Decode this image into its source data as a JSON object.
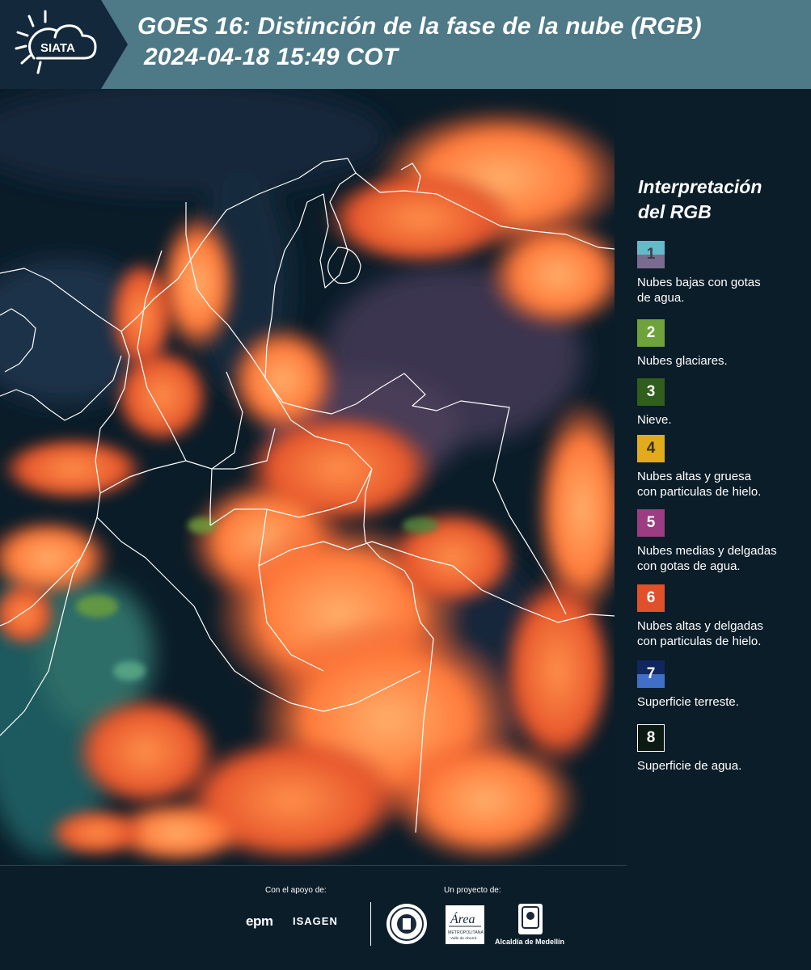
{
  "header": {
    "logo_text": "SIATA",
    "title_line1": "GOES 16: Distinción de la fase de la nube (RGB)",
    "title_line2": "2024-04-18 15:49 COT"
  },
  "legend": {
    "title_line1": "Interpretación",
    "title_line2": "del RGB",
    "items": [
      {
        "number": "1",
        "label_line1": "Nubes bajas con gotas",
        "label_line2": "de agua.",
        "color_top": "#66b9c8",
        "color_bottom": "#7a6c8e"
      },
      {
        "number": "2",
        "label_line1": "Nubes glaciares.",
        "label_line2": "",
        "color": "#6ea23a"
      },
      {
        "number": "3",
        "label_line1": "Nieve.",
        "label_line2": "",
        "color": "#2f5e1d"
      },
      {
        "number": "4",
        "label_line1": "Nubes altas y gruesa",
        "label_line2": "con particulas de hielo.",
        "color": "#e1ab1e"
      },
      {
        "number": "5",
        "label_line1": "Nubes medias y delgadas",
        "label_line2": "con gotas de agua.",
        "color": "#9b3d80"
      },
      {
        "number": "6",
        "label_line1": "Nubes altas y delgadas",
        "label_line2": "con particulas de hielo.",
        "color": "#e0502b"
      },
      {
        "number": "7",
        "label_line1": "Superficie terreste.",
        "label_line2": "",
        "color_top": "#10265e",
        "color_bottom": "#3f6fc6"
      },
      {
        "number": "8",
        "label_line1": "Superficie de agua.",
        "label_line2": "",
        "color": "#0c1a14"
      }
    ]
  },
  "footer": {
    "support_label": "Con el apoyo de:",
    "project_label": "Un proyecto de:",
    "sponsor1": "epm",
    "sponsor2": "ISAGEN",
    "partner_area_1": "Área",
    "partner_area_2": "METROPOLITANA",
    "partner_area_3": "Valle de Aburrá",
    "partner_medellin": "Alcaldía de Medellín"
  },
  "colors": {
    "header_bg": "#4e7986",
    "page_bg": "#0b1d29",
    "cloud_orange": "#ff7a3a",
    "border_line": "#ffffff"
  }
}
